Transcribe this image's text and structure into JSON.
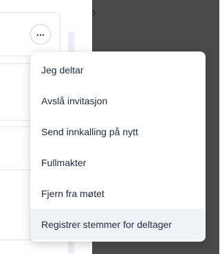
{
  "backdrop": {
    "color": "#4a4a4a",
    "glyph": "?"
  },
  "more_button": {
    "label": "..."
  },
  "menu": {
    "items": [
      {
        "label": "Jeg deltar"
      },
      {
        "label": "Avslå invitasjon"
      },
      {
        "label": "Send innkalling på nytt"
      },
      {
        "label": "Fullmakter"
      },
      {
        "label": "Fjern fra møtet"
      },
      {
        "label": "Registrer stemmer for deltager"
      }
    ],
    "highlight_color": "#eef3f8"
  }
}
